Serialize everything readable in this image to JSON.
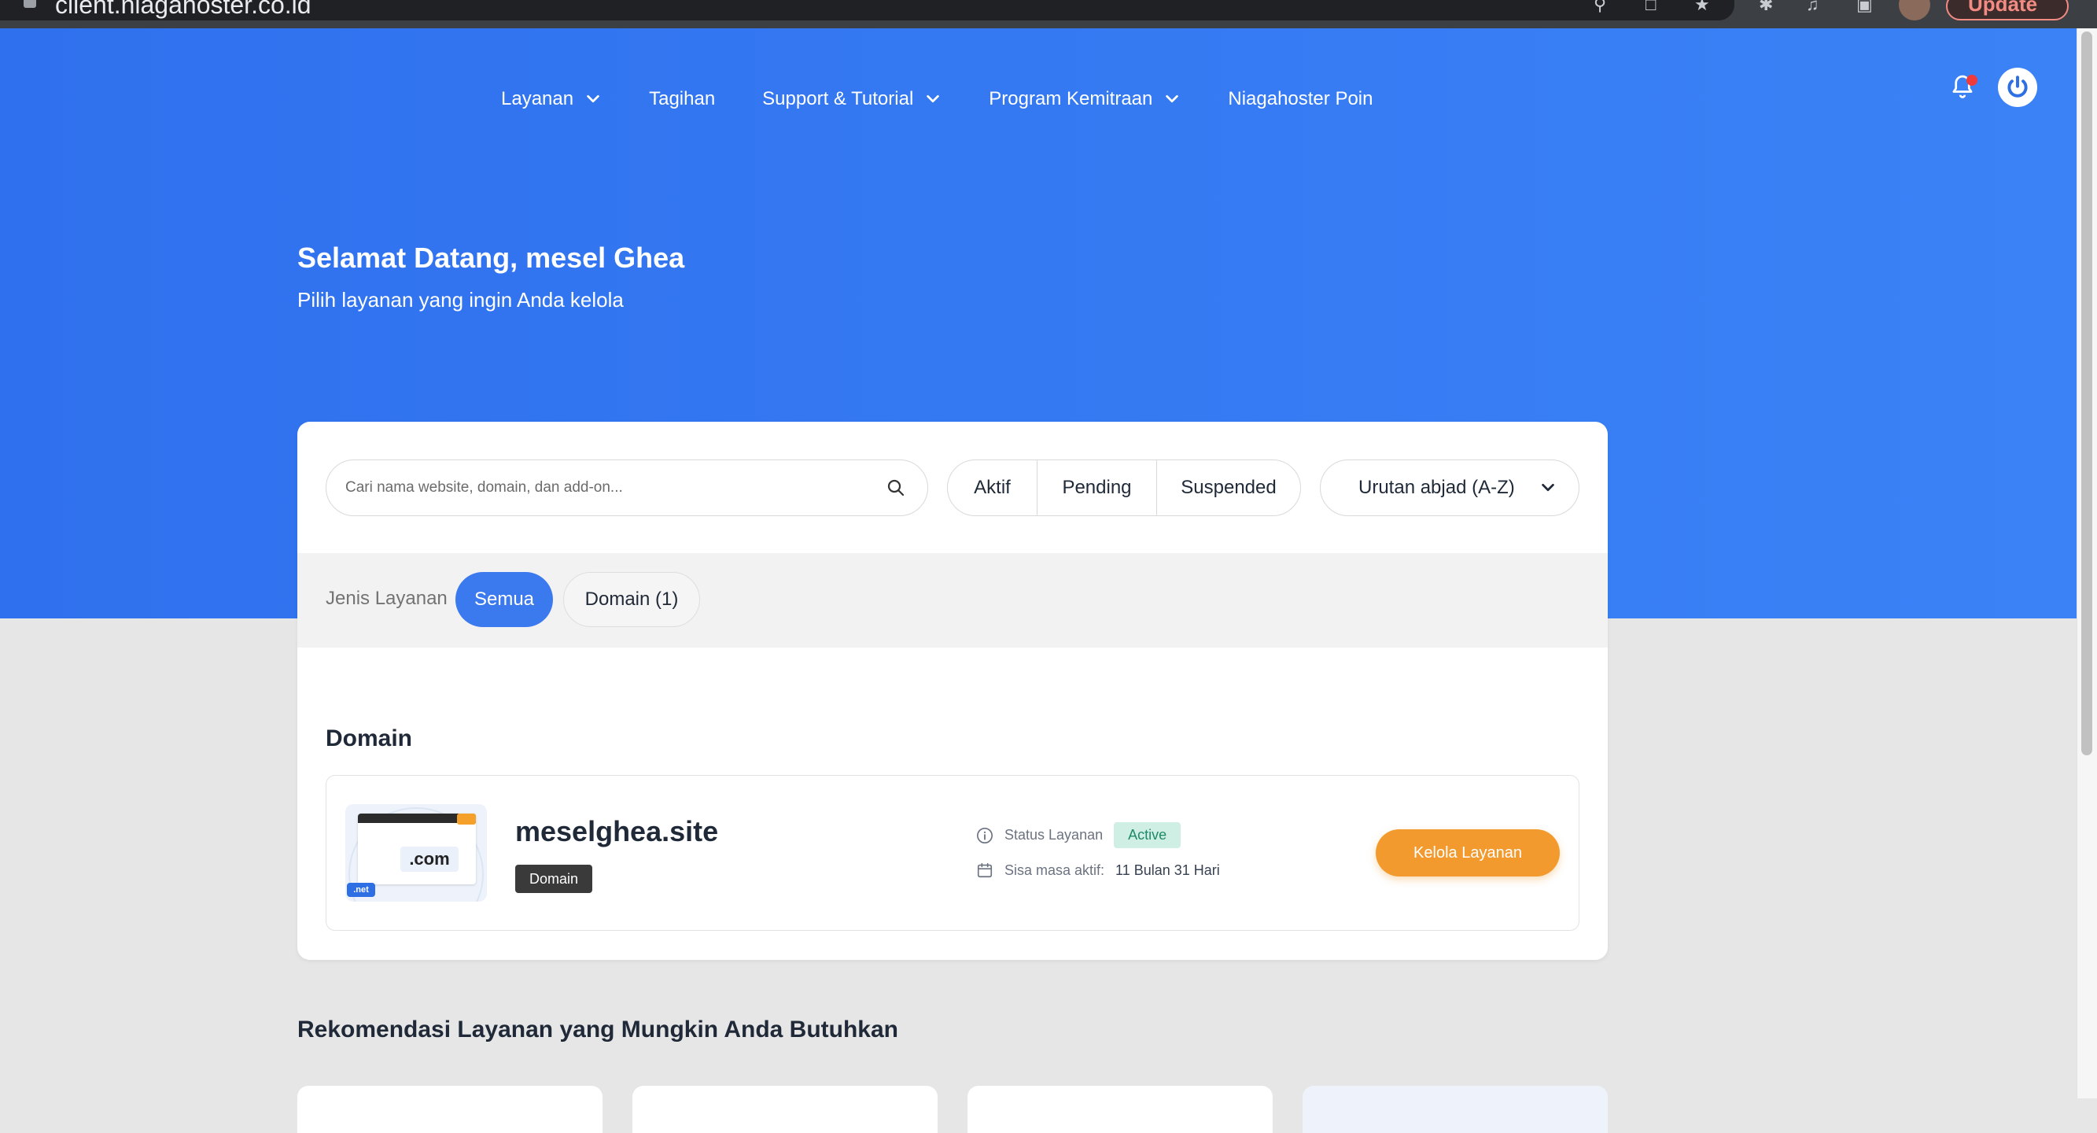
{
  "browser": {
    "url": "client.niagahoster.co.id",
    "update_label": "Update"
  },
  "nav": {
    "items": [
      {
        "label": "Layanan",
        "has_dropdown": true
      },
      {
        "label": "Tagihan",
        "has_dropdown": false
      },
      {
        "label": "Support & Tutorial",
        "has_dropdown": true
      },
      {
        "label": "Program Kemitraan",
        "has_dropdown": true
      },
      {
        "label": "Niagahoster Poin",
        "has_dropdown": false
      }
    ],
    "icons": [
      "bell-icon",
      "power-icon"
    ]
  },
  "hero": {
    "title": "Selamat Datang, mesel Ghea",
    "subtitle": "Pilih layanan yang ingin Anda kelola"
  },
  "filters": {
    "search_placeholder": "Cari nama website, domain, dan add-on...",
    "status_options": [
      "Aktif",
      "Pending",
      "Suspended"
    ],
    "sort_selected": "Urutan abjad (A-Z)",
    "service_type_label": "Jenis Layanan",
    "service_type_active": "Semua",
    "service_type_other": "Domain (1)"
  },
  "section": {
    "title": "Domain",
    "service": {
      "thumbnail_text": ".com",
      "thumbnail_tag": ".net",
      "name": "meselghea.site",
      "badge": "Domain",
      "status_label": "Status Layanan",
      "status_value": "Active",
      "remaining_label": "Sisa masa aktif:",
      "remaining_value": "11 Bulan 31 Hari",
      "action_label": "Kelola Layanan"
    }
  },
  "recommendations": {
    "title": "Rekomendasi Layanan yang Mungkin Anda Butuhkan"
  },
  "colors": {
    "hero_blue": "#3478f2",
    "active_pill": "#3b79ee",
    "accent_orange": "#f29a2e",
    "status_green_bg": "#cfeee4",
    "status_green_text": "#1f8a68"
  }
}
